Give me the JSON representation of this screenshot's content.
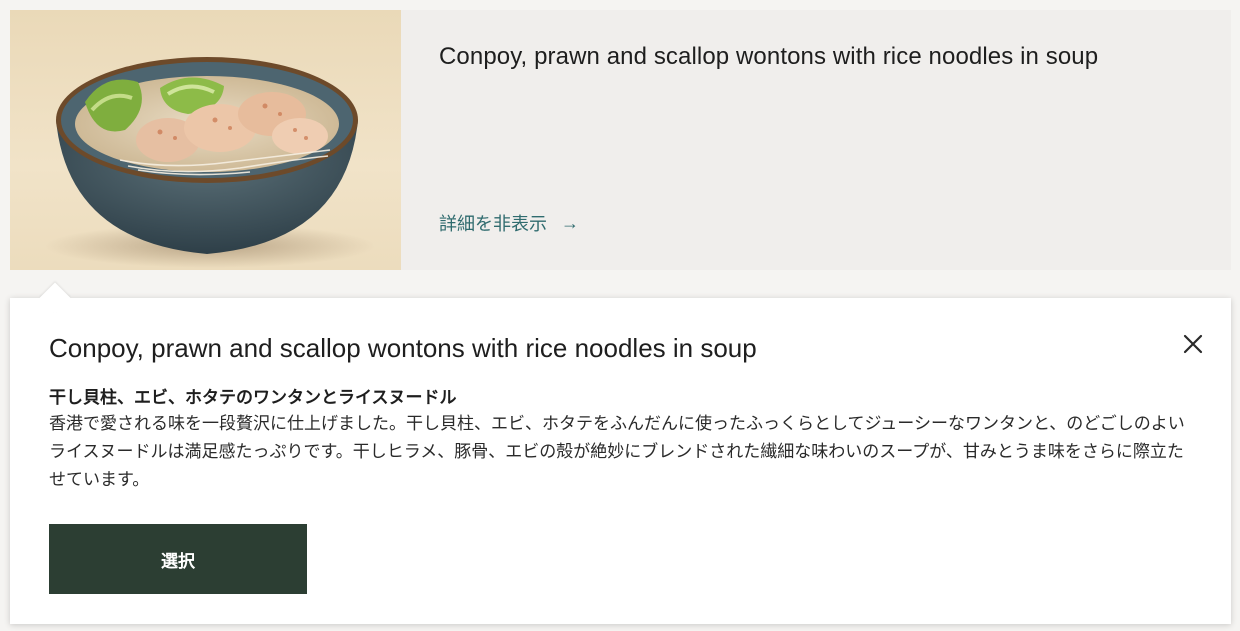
{
  "card": {
    "title": "Conpoy, prawn and scallop wontons with rice noodles in soup",
    "toggle_label": "詳細を非表示",
    "toggle_arrow": "→",
    "image_icon": "noodle-soup-bowl-image"
  },
  "detail": {
    "title": "Conpoy, prawn and scallop wontons with rice noodles in soup",
    "jp_name": "干し貝柱、エビ、ホタテのワンタンとライスヌードル",
    "description": "香港で愛される味を一段贅沢に仕上げました。干し貝柱、エビ、ホタテをふんだんに使ったふっくらとしてジューシーなワンタンと、のどごしのよいライスヌードルは満足感たっぷりです。干しヒラメ、豚骨、エビの殻が絶妙にブレンドされた繊細な味わいのスープが、甘みとうま味をさらに際立たせています。",
    "select_label": "選択",
    "close_icon": "close-icon"
  },
  "colors": {
    "accent_link": "#2f6b6e",
    "button_bg": "#2c3e33",
    "card_bg": "#f0eeec"
  }
}
